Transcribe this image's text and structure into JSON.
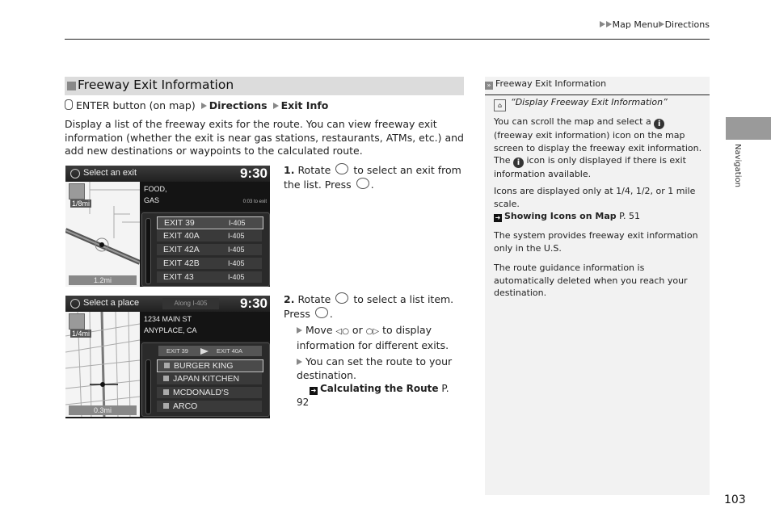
{
  "breadcrumb": {
    "items": [
      "Map Menu",
      "Directions"
    ]
  },
  "section": {
    "title": "Freeway Exit Information"
  },
  "path": {
    "prefix": "ENTER button (on map)",
    "step1": "Directions",
    "step2": "Exit Info"
  },
  "intro": "Display a list of the freeway exits for the route. You can view freeway exit information (whether the exit is near gas stations, restaurants, ATMs, etc.) and add new destinations or waypoints to the calculated route.",
  "screen1": {
    "title": "Select an exit",
    "clock": "9:30",
    "scale": "1/8mi",
    "map_footer": "1.2mi",
    "info_line1": "FOOD,",
    "info_line2": "GAS",
    "eta": "0:03 to exit",
    "rows": [
      {
        "name": "EXIT 39",
        "road": "I-405",
        "selected": true
      },
      {
        "name": "EXIT 40A",
        "road": "I-405",
        "selected": false
      },
      {
        "name": "EXIT 42A",
        "road": "I-405",
        "selected": false
      },
      {
        "name": "EXIT 42B",
        "road": "I-405",
        "selected": false
      },
      {
        "name": "EXIT 43",
        "road": "I-405",
        "selected": false
      }
    ]
  },
  "screen2": {
    "title": "Select a place",
    "along": "Along I-405",
    "clock": "9:30",
    "scale": "1/4mi",
    "map_footer": "0.3mi",
    "info_line1": "1234 MAIN  ST",
    "info_line2": "ANYPLACE, CA",
    "tab_from": "EXIT 39",
    "tab_to": "EXIT 40A",
    "rows": [
      {
        "name": "BURGER KING",
        "selected": true
      },
      {
        "name": "JAPAN KITCHEN",
        "selected": false
      },
      {
        "name": "MCDONALD'S",
        "selected": false
      },
      {
        "name": "ARCO",
        "selected": false
      }
    ]
  },
  "steps": {
    "s1_num": "1.",
    "s1_a": "Rotate",
    "s1_b": "to select an exit from the list. Press",
    "s1_c": ".",
    "s2_num": "2.",
    "s2_a": "Rotate",
    "s2_b": "to select a list item. Press",
    "s2_c": ".",
    "sub1_a": "Move",
    "sub1_b": "or",
    "sub1_c": "to display information for different exits.",
    "sub2": "You can set the route to your destination.",
    "ref_title": "Calculating the Route",
    "ref_page": "P. 92"
  },
  "sidebar": {
    "header": "Freeway Exit Information",
    "voice_command": "“Display Freeway Exit Information”",
    "p1_a": "You can scroll the map and select a",
    "p1_b": "(freeway exit information) icon on the map screen to display the freeway exit information. The",
    "p1_c": "icon is only displayed if there is exit information available.",
    "p2": "Icons are displayed only at 1/4, 1/2, or 1 mile scale.",
    "ref_title": "Showing Icons on Map",
    "ref_page": "P. 51",
    "p3": "The system provides freeway exit information only in the U.S.",
    "p4": "The route guidance information is automatically deleted when you reach your destination."
  },
  "side_tab": "Navigation",
  "page_number": "103"
}
